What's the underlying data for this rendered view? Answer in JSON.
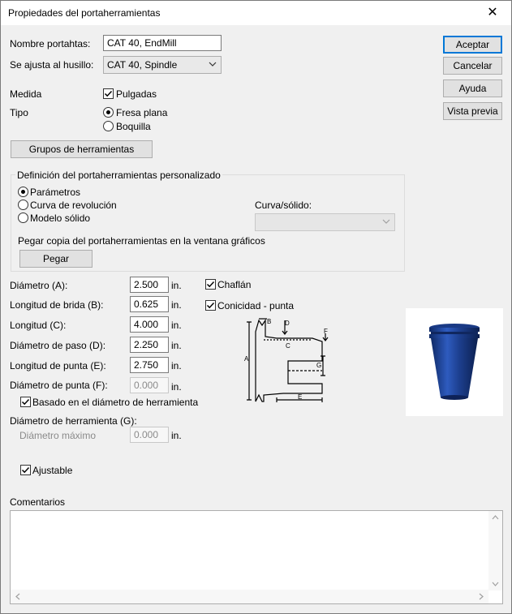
{
  "window": {
    "title": "Propiedades del portaherramientas",
    "close_glyph": "✕"
  },
  "holder": {
    "name_label": "Nombre portahtas:",
    "name_value": "CAT 40, EndMill",
    "spindle_label": "Se ajusta al husillo:",
    "spindle_value": "CAT 40, Spindle"
  },
  "buttons": {
    "ok": "Aceptar",
    "cancel": "Cancelar",
    "help": "Ayuda",
    "preview": "Vista previa"
  },
  "units": {
    "label": "Medida",
    "inches_label": "Pulgadas",
    "inches_checked": true
  },
  "type": {
    "label": "Tipo",
    "options": [
      "Fresa plana",
      "Boquilla"
    ],
    "selected": "Fresa plana"
  },
  "tool_groups_button": "Grupos de herramientas",
  "custom": {
    "title": "Definición del portaherramientas personalizado",
    "options": [
      "Parámetros",
      "Curva de revolución",
      "Modelo sólido"
    ],
    "selected": "Parámetros",
    "curve_label": "Curva/sólido:",
    "curve_value": "",
    "paste_label": "Pegar copia del portaherramientas en la ventana gráficos",
    "paste_button": "Pegar"
  },
  "params": {
    "unit": "in.",
    "diameter": {
      "label": "Diámetro (A):",
      "value": "2.500"
    },
    "flange_length": {
      "label": "Longitud de brida (B):",
      "value": "0.625"
    },
    "length": {
      "label": "Longitud (C):",
      "value": "4.000"
    },
    "step_diameter": {
      "label": "Diámetro de paso (D):",
      "value": "2.250"
    },
    "tip_length": {
      "label": "Longitud de punta (E):",
      "value": "2.750"
    },
    "tip_diameter": {
      "label": "Diámetro de punta (F):",
      "value": "0.000"
    },
    "based_on_tool": {
      "label": "Basado en el diámetro de herramienta",
      "checked": true
    },
    "tool_diameter_label": "Diámetro de herramienta (G):",
    "max_diameter": {
      "label": "Diámetro máximo",
      "value": "0.000"
    },
    "adjustable": {
      "label": "Ajustable",
      "checked": true
    }
  },
  "options": {
    "chamfer": {
      "label": "Chaflán",
      "checked": true
    },
    "taper_tip": {
      "label": "Conicidad - punta",
      "checked": true
    }
  },
  "diagram_labels": {
    "a": "A",
    "b": "B",
    "c": "C",
    "d": "D",
    "e": "E",
    "f": "F",
    "g": "G"
  },
  "comments": {
    "label": "Comentarios",
    "value": ""
  },
  "colors": {
    "accent": "#0078d7",
    "holder_blue": "#1f3f8a"
  }
}
